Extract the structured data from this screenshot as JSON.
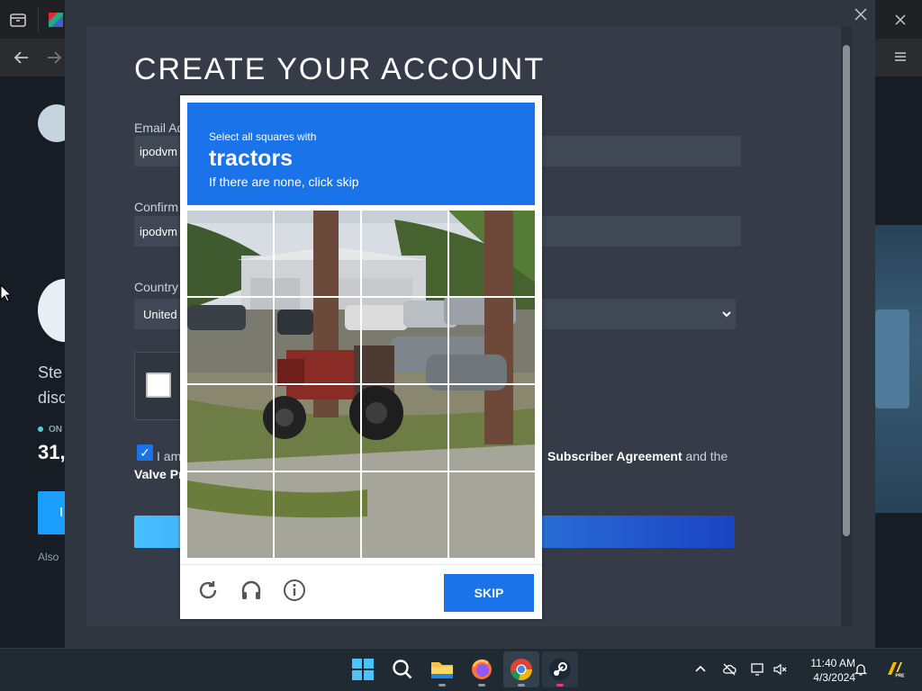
{
  "browser": {
    "title": "Create Your Account"
  },
  "background_page": {
    "headline_fragment": "Ste",
    "headline_fragment2": "disc",
    "online_label": "ON",
    "count_fragment": "31,",
    "button_fragment": "I",
    "also_fragment": "Also"
  },
  "form": {
    "title": "CREATE YOUR ACCOUNT",
    "email_label": "Email Ad",
    "email_value": "ipodvm",
    "confirm_label": "Confirm",
    "confirm_value": "ipodvm",
    "country_label": "Country",
    "country_value": "United",
    "agree_text_left": "I am",
    "agree_text_right_bold": "Subscriber Agreement",
    "agree_text_right_tail": " and the",
    "agree_text_line2": "Valve Pr",
    "agree_checked": true
  },
  "captcha": {
    "line1": "Select all squares with",
    "target": "tractors",
    "line3": "If there are none, click skip",
    "skip_label": "SKIP",
    "grid_rows": 4,
    "grid_cols": 4,
    "icons": [
      "refresh-icon",
      "audio-icon",
      "info-icon"
    ]
  },
  "taskbar": {
    "time": "11:40 AM",
    "date": "4/3/2024",
    "apps": [
      "start",
      "search",
      "file-explorer",
      "firefox",
      "chrome",
      "steam"
    ]
  },
  "colors": {
    "captcha_blue": "#1a73e8",
    "steam_dark": "#171d25",
    "modal_bg": "#2f3640"
  }
}
